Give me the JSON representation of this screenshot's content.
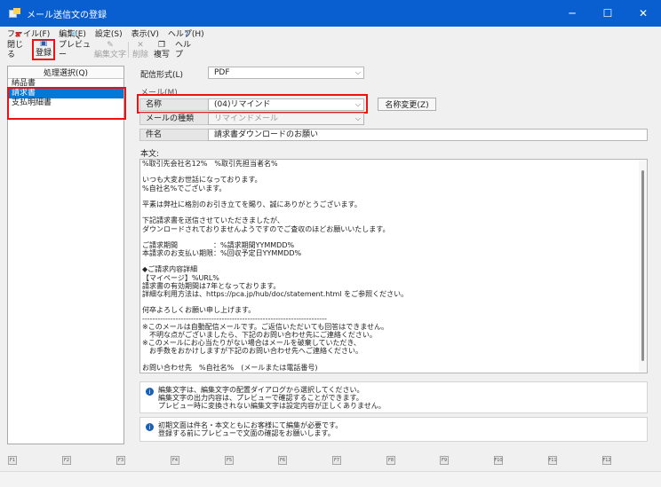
{
  "window": {
    "title": "メール送信文の登録",
    "minimize": "─",
    "maximize": "☐",
    "close": "✕"
  },
  "menu": [
    {
      "label": "ファイル(F)"
    },
    {
      "label": "編集(E)"
    },
    {
      "label": "設定(S)"
    },
    {
      "label": "表示(V)"
    },
    {
      "label": "ヘルプ(H)"
    }
  ],
  "toolbar": {
    "close": {
      "icon": "close-icon",
      "glyph": "✖",
      "label": "閉じる"
    },
    "register": {
      "icon": "save-icon",
      "glyph": "▣",
      "label": "登録"
    },
    "preview": {
      "icon": "preview-icon",
      "glyph": "🔍",
      "label": "プレビュー"
    },
    "edit_text": {
      "icon": "edit-icon",
      "glyph": "✎",
      "label": "編集文字"
    },
    "delete": {
      "icon": "delete-icon",
      "glyph": "✕",
      "label": "削除"
    },
    "copy": {
      "icon": "copy-icon",
      "glyph": "❐",
      "label": "複写"
    },
    "help": {
      "icon": "help-icon",
      "glyph": "?",
      "label": "ヘルプ"
    }
  },
  "left_panel": {
    "header": "処理選択(Q)",
    "items": [
      {
        "label": "納品書"
      },
      {
        "label": "請求書"
      },
      {
        "label": "支払明細書"
      }
    ]
  },
  "form": {
    "delivery_format_label": "配信形式(L)",
    "delivery_format_value": "PDF",
    "mail_section_label": "メール(M)",
    "name_label": "名称",
    "name_value": "(04)リマインド",
    "rename_button": "名称変更(Z)",
    "mail_type_label": "メールの種類",
    "mail_type_value": "リマインドメール",
    "subject_label": "件名",
    "subject_value": "請求書ダウンロードのお願い",
    "body_label": "本文:"
  },
  "body_lines": [
    "%取引先会社名12%　%取引先担当者名%",
    "",
    "いつも大変お世話になっております。",
    "%自社名%でございます。",
    "",
    "平素は弊社に格別のお引き立てを賜り、誠にありがとうございます。",
    "",
    "下記請求書を送信させていただきましたが、",
    "ダウンロードされておりませんようですのでご査収のほどお願いいたします。",
    "",
    "ご請求期間　　　　　：%請求期間YYMMDD%",
    "本請求のお支払い期限：%回収予定日YYMMDD%",
    "",
    "◆ご請求内容詳細",
    "【マイページ】%URL%",
    "請求書の有効期間は7年となっております。",
    "詳細な利用方法は、https://pca.jp/hub/doc/statement.html をご参照ください。",
    "",
    "何卒よろしくお願い申し上げます。",
    "------------------------------------------------------------------------",
    "※このメールは自動配信メールです。ご返信いただいても回答はできません。",
    "　不明な点がございましたら、下記のお問い合わせ先にご連絡ください。",
    "※このメールにお心当たりがない場合はメールを破棄していただき、",
    "　お手数をおかけしますが下記のお問い合わせ先へご連絡ください。",
    "",
    "お問い合わせ先　%自社名%　(メールまたは電話番号)"
  ],
  "info_boxes": [
    {
      "icon": "info-icon",
      "lines": [
        "編集文字は、編集文字の配置ダイアログから選択してください。",
        "編集文字の出力内容は、プレビューで確認することができます。",
        "プレビュー時に変換されない編集文字は設定内容が正しくありません。"
      ]
    },
    {
      "icon": "info-icon",
      "lines": [
        "初期文面は件名・本文ともにお客様にて編集が必要です。",
        "登録する前にプレビューで文面の確認をお願いします。"
      ]
    }
  ],
  "function_keys": [
    "F1",
    "F2",
    "F3",
    "F4",
    "F5",
    "F6",
    "F7",
    "F8",
    "F9",
    "F10",
    "F11",
    "F12"
  ]
}
